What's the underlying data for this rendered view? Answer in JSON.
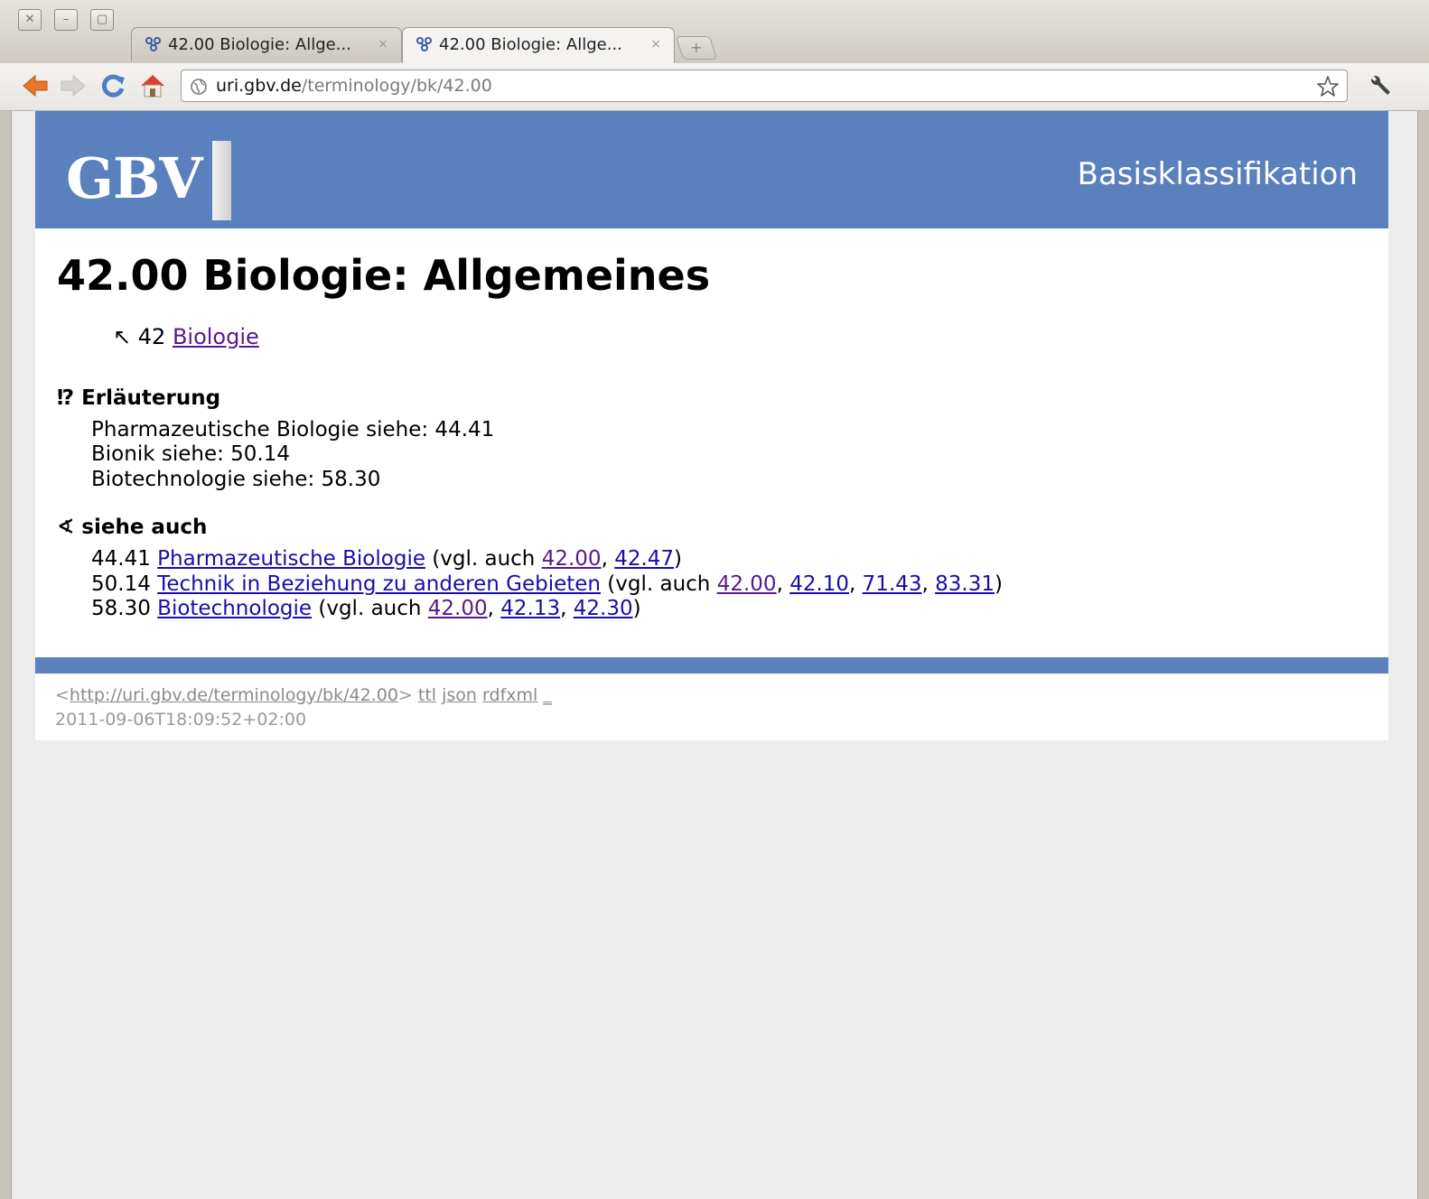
{
  "browser": {
    "window_controls": [
      "✕",
      "–",
      "▢"
    ],
    "tabs": [
      {
        "title": "42.00 Biologie: Allge...",
        "close": "×",
        "active": false
      },
      {
        "title": "42.00 Biologie: Allge...",
        "close": "×",
        "active": true
      }
    ],
    "address": {
      "host": "uri.gbv.de",
      "path": "/terminology/bk/42.00"
    }
  },
  "colors": {
    "banner": "#5a80bd",
    "link": "#1a0dab",
    "link_visited": "#551a8b"
  },
  "header": {
    "logo": "GBV",
    "title": "Basisklassifikation"
  },
  "page": {
    "title": "42.00 Biologie: Allgemeines",
    "broader": {
      "arrow": "↖",
      "notation": "42",
      "label": "Biologie"
    },
    "explanation": {
      "heading": "⁉ Erläuterung",
      "lines": [
        "Pharmazeutische Biologie siehe: 44.41",
        "Bionik siehe: 50.14",
        "Biotechnologie siehe: 58.30"
      ]
    },
    "see_also": {
      "heading": "∢ siehe auch",
      "vgl_prefix": " (vgl. auch ",
      "items": [
        {
          "notation": "44.41",
          "label": "Pharmazeutische Biologie",
          "refs": [
            "42.00",
            "42.47"
          ]
        },
        {
          "notation": "50.14",
          "label": "Technik in Beziehung zu anderen Gebieten",
          "refs": [
            "42.00",
            "42.10",
            "71.43",
            "83.31"
          ]
        },
        {
          "notation": "58.30",
          "label": "Biotechnologie",
          "refs": [
            "42.00",
            "42.13",
            "42.30"
          ]
        }
      ]
    }
  },
  "footer": {
    "uri": "http://uri.gbv.de/terminology/bk/42.00",
    "formats": [
      "ttl",
      "json",
      "rdfxml",
      "_"
    ],
    "timestamp": "2011-09-06T18:09:52+02:00"
  }
}
